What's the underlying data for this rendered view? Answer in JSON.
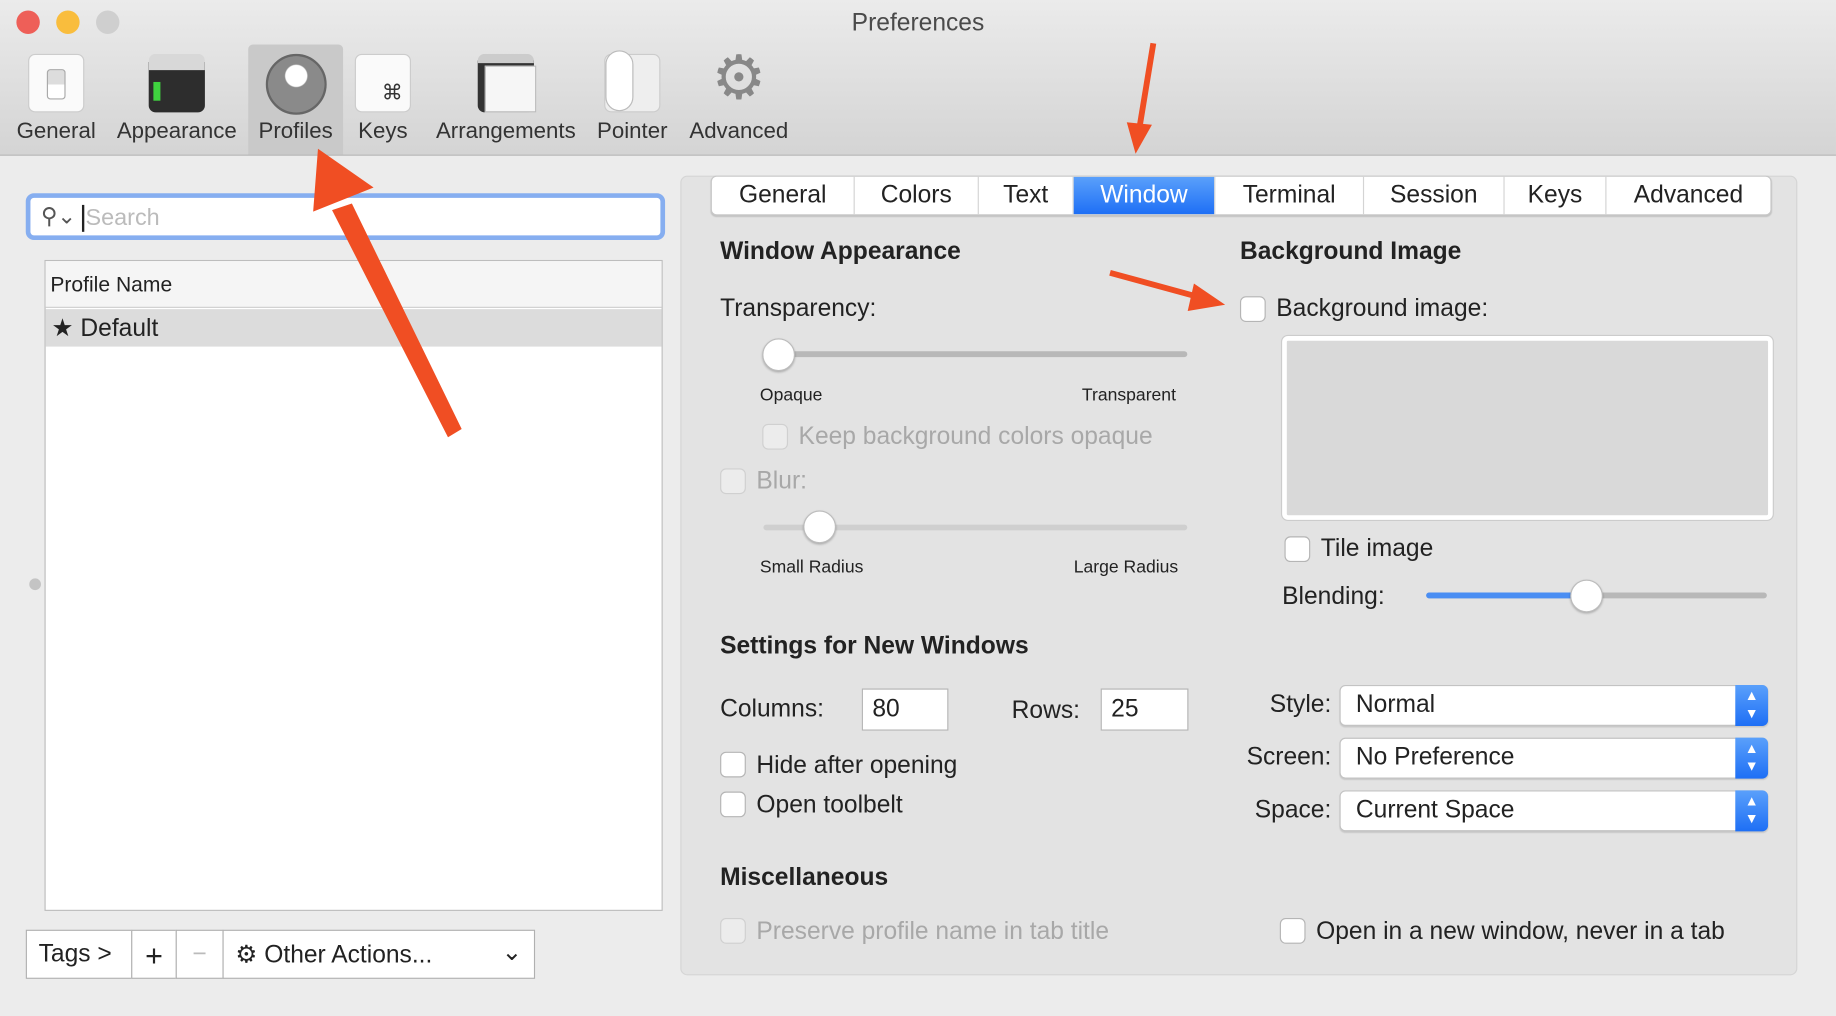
{
  "window": {
    "title": "Preferences"
  },
  "colors": {
    "close": "#ee5f58",
    "minimize": "#f9bd3d",
    "zoom": "#cfcfcf",
    "accent": "#2f7cf6",
    "annotation_arrow": "#f04e23"
  },
  "toolbar": {
    "items": [
      {
        "label": "General",
        "icon": "switch-icon"
      },
      {
        "label": "Appearance",
        "icon": "terminal-window-icon"
      },
      {
        "label": "Profiles",
        "icon": "user-silhouette-icon",
        "selected": true
      },
      {
        "label": "Keys",
        "icon": "command-key-icon"
      },
      {
        "label": "Arrangements",
        "icon": "windows-icon"
      },
      {
        "label": "Pointer",
        "icon": "mouse-icon"
      },
      {
        "label": "Advanced",
        "icon": "gear-icon"
      }
    ]
  },
  "sidebar": {
    "search": {
      "placeholder": "Search",
      "value": ""
    },
    "table": {
      "header": "Profile Name",
      "rows": [
        {
          "name": "Default",
          "default": true,
          "selected": true
        }
      ]
    },
    "bottom": {
      "tags": "Tags >",
      "add": "+",
      "remove": "−",
      "other_actions": "Other Actions..."
    }
  },
  "tabs": [
    {
      "label": "General"
    },
    {
      "label": "Colors"
    },
    {
      "label": "Text"
    },
    {
      "label": "Window",
      "active": true
    },
    {
      "label": "Terminal"
    },
    {
      "label": "Session"
    },
    {
      "label": "Keys"
    },
    {
      "label": "Advanced"
    }
  ],
  "window_appearance": {
    "heading": "Window Appearance",
    "transparency_label": "Transparency:",
    "transparency_value": 0,
    "opaque": "Opaque",
    "transparent": "Transparent",
    "keep_bg_opaque": {
      "label": "Keep background colors opaque",
      "checked": false,
      "disabled": true
    },
    "blur": {
      "label": "Blur:",
      "checked": false,
      "disabled": true
    },
    "blur_radius_value": 0.1,
    "small_radius": "Small Radius",
    "large_radius": "Large Radius"
  },
  "background_image": {
    "heading": "Background Image",
    "enable": {
      "label": "Background image:",
      "checked": false
    },
    "tile": {
      "label": "Tile image",
      "checked": false
    },
    "blending_label": "Blending:",
    "blending_value": 0.47
  },
  "new_windows": {
    "heading": "Settings for New Windows",
    "columns_label": "Columns:",
    "columns": "80",
    "rows_label": "Rows:",
    "rows": "25",
    "hide_after_opening": {
      "label": "Hide after opening",
      "checked": false
    },
    "open_toolbelt": {
      "label": "Open toolbelt",
      "checked": false
    },
    "style_label": "Style:",
    "style": "Normal",
    "screen_label": "Screen:",
    "screen": "No Preference",
    "space_label": "Space:",
    "space": "Current Space"
  },
  "misc": {
    "heading": "Miscellaneous",
    "preserve_name": {
      "label": "Preserve profile name in tab title",
      "checked": false,
      "disabled": true
    },
    "new_window": {
      "label": "Open in a new window, never in a tab",
      "checked": false
    }
  }
}
